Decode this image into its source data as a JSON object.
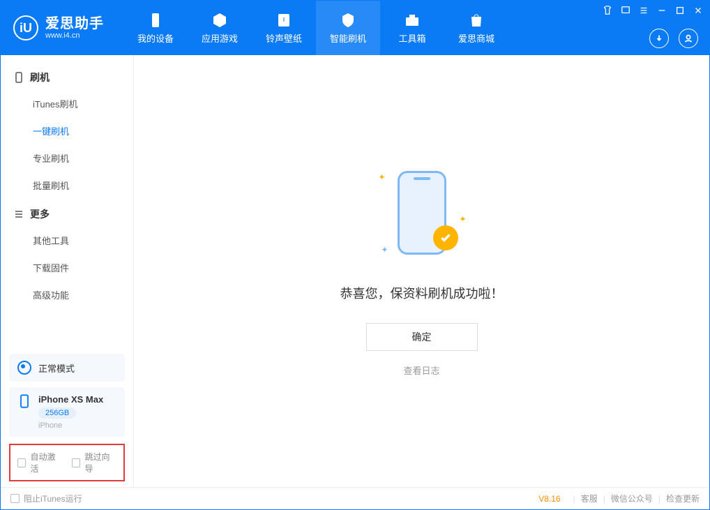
{
  "brand": {
    "title": "爱思助手",
    "subtitle": "www.i4.cn",
    "logo_letter": "iU"
  },
  "nav": {
    "tabs": [
      {
        "label": "我的设备"
      },
      {
        "label": "应用游戏"
      },
      {
        "label": "铃声壁纸"
      },
      {
        "label": "智能刷机"
      },
      {
        "label": "工具箱"
      },
      {
        "label": "爱思商城"
      }
    ],
    "active_index": 3
  },
  "sidebar": {
    "section_flash": {
      "title": "刷机"
    },
    "flash_items": [
      {
        "label": "iTunes刷机"
      },
      {
        "label": "一键刷机"
      },
      {
        "label": "专业刷机"
      },
      {
        "label": "批量刷机"
      }
    ],
    "flash_active_index": 1,
    "section_more": {
      "title": "更多"
    },
    "more_items": [
      {
        "label": "其他工具"
      },
      {
        "label": "下载固件"
      },
      {
        "label": "高级功能"
      }
    ]
  },
  "mode_card": {
    "label": "正常模式"
  },
  "device": {
    "name": "iPhone XS Max",
    "storage": "256GB",
    "type": "iPhone"
  },
  "checkboxes": {
    "auto_activate": "自动激活",
    "skip_guide": "跳过向导"
  },
  "main": {
    "success_message": "恭喜您，保资料刷机成功啦！",
    "ok_button": "确定",
    "view_log": "查看日志"
  },
  "footer": {
    "block_itunes": "阻止iTunes运行",
    "version": "V8.16",
    "links": {
      "support": "客服",
      "wechat": "微信公众号",
      "check_update": "检查更新"
    }
  }
}
